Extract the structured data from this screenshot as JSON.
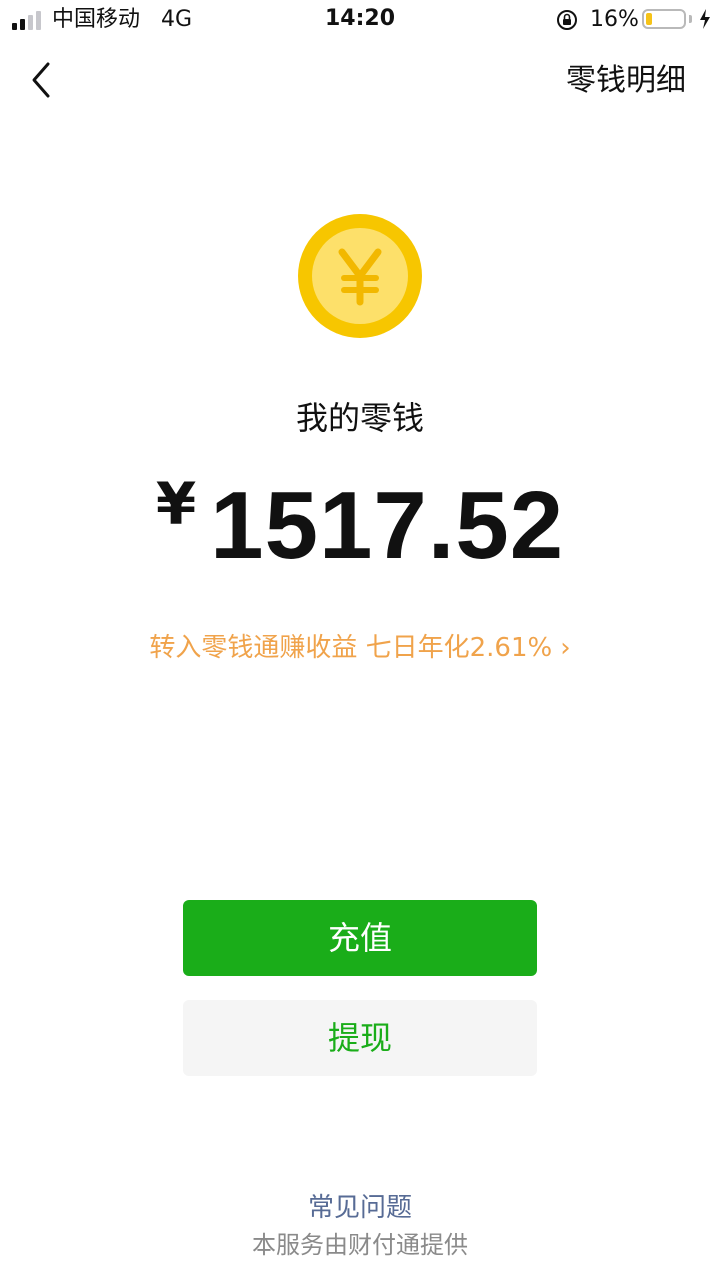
{
  "status_bar": {
    "carrier": "中国移动",
    "network": "4G",
    "time": "14:20",
    "battery_percent": "16%",
    "battery_level": 0.16,
    "icons": [
      "signal-icon",
      "orientation-lock-icon",
      "battery-icon",
      "charging-bolt-icon"
    ]
  },
  "nav": {
    "back_icon": "chevron-left-icon",
    "action_label": "零钱明细"
  },
  "wallet": {
    "icon": "coin-yen-icon",
    "label": "我的零钱",
    "currency_symbol": "¥",
    "amount": "1517.52",
    "promo_text": "转入零钱通赚收益 七日年化2.61%",
    "promo_chevron": "›"
  },
  "actions": {
    "topup_label": "充值",
    "withdraw_label": "提现"
  },
  "footer": {
    "faq_label": "常见问题",
    "provider_note": "本服务由财付通提供"
  },
  "colors": {
    "primary_green": "#1aad19",
    "promo_orange": "#f0a34b",
    "link_blue": "#576b95",
    "coin_gold": "#f7c600",
    "coin_inner": "#fde06a"
  }
}
